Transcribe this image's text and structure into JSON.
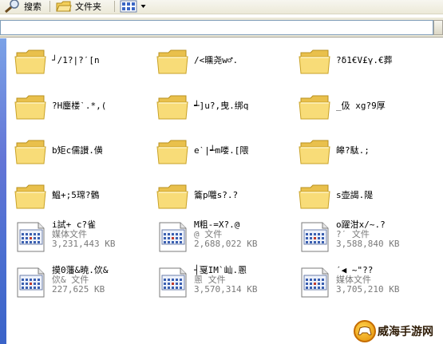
{
  "toolbar": {
    "search_label": "搜索",
    "folders_label": "文件夹"
  },
  "address": {
    "value": ""
  },
  "folders": [
    {
      "name": "┘/1?|?ˊ[n"
    },
    {
      "name": "/<曛尧w♂."
    },
    {
      "name": "?δ1€V£γ.€葬"
    },
    {
      "name": "?H鏖楼ˋ.*,("
    },
    {
      "name": "┵]u?,曳.绑q"
    },
    {
      "name": "_伋  xg?9厚"
    },
    {
      "name": "b矩c儒讃.僙"
    },
    {
      "name": "eˋ|┵m喽.[隈"
    },
    {
      "name": "皞?駄.;"
    },
    {
      "name": "鰛+;5瑺?鶻"
    },
    {
      "name": "籥p囖s?.?"
    },
    {
      "name": "s壶謁.隄"
    }
  ],
  "files": [
    {
      "name": "i試+  c?雀",
      "type": "媒体文件",
      "size": "3,231,443 KB"
    },
    {
      "name": "M粗-=X?.@",
      "type": "@  文件",
      "size": "2,688,022 KB"
    },
    {
      "name": "o躍泔x/~.?",
      "type": "?ˊ 文件",
      "size": "3,588,840 KB"
    },
    {
      "name": "摸0藩&暁.佽&",
      "type": "佽& 文件",
      "size": "227,625 KB"
    },
    {
      "name": "┤戛IM`屾.慁",
      "type": "慁 文件",
      "size": "3,570,314 KB"
    },
    {
      "name": "ˊ◀  ~\"??",
      "type": "媒体文件",
      "size": "3,705,210 KB"
    }
  ],
  "watermark": {
    "text": "威海手游网"
  },
  "colors": {
    "folder_fill": "#f7d86b",
    "folder_stroke": "#c9a227",
    "sidebar_blue": "#6375d6",
    "meta_gray": "#7a7a7a"
  }
}
